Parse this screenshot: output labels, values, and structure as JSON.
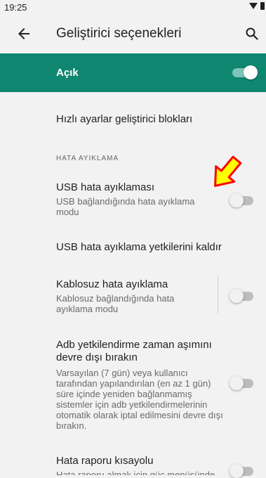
{
  "status_bar": {
    "time": "19:25"
  },
  "app_bar": {
    "title": "Geliştirici seçenekleri",
    "back_icon": "arrow-left-icon",
    "search_icon": "search-icon"
  },
  "master_switch": {
    "label": "Açık",
    "state": "on",
    "color": "#0e8670"
  },
  "items": {
    "quick_tiles": {
      "title": "Hızlı ayarlar geliştirici blokları"
    },
    "section_header": "HATA AYIKLAMA",
    "usb_debugging": {
      "title": "USB hata ayıklaması",
      "summary": "USB bağlandığında hata ayıklama modu",
      "state": "off"
    },
    "revoke_usb": {
      "title": "USB hata ayıklama yetkilerini kaldır"
    },
    "wireless_debugging": {
      "title": "Kablosuz hata ayıklama",
      "summary": "Kablosuz bağlandığında hata ayıklama modu",
      "state": "off"
    },
    "adb_timeout": {
      "title": "Adb yetkilendirme zaman aşımını devre dışı bırakın",
      "summary": "Varsayılan (7 gün) veya kullanıcı tarafından yapılandırılan (en az 1 gün) süre içinde yeniden bağlanmamış sistemler için adb yetkilendirmelerinin otomatik olarak iptal edilmesini devre dışı bırakın.",
      "state": "off"
    },
    "bug_report": {
      "title": "Hata raporu kısayolu",
      "summary": "Hata raporu almak için güç menüsünde bir düğme göster",
      "state": "off"
    }
  },
  "annotation": {
    "arrow_fill": "#ffff00",
    "arrow_stroke": "#ff0000"
  }
}
